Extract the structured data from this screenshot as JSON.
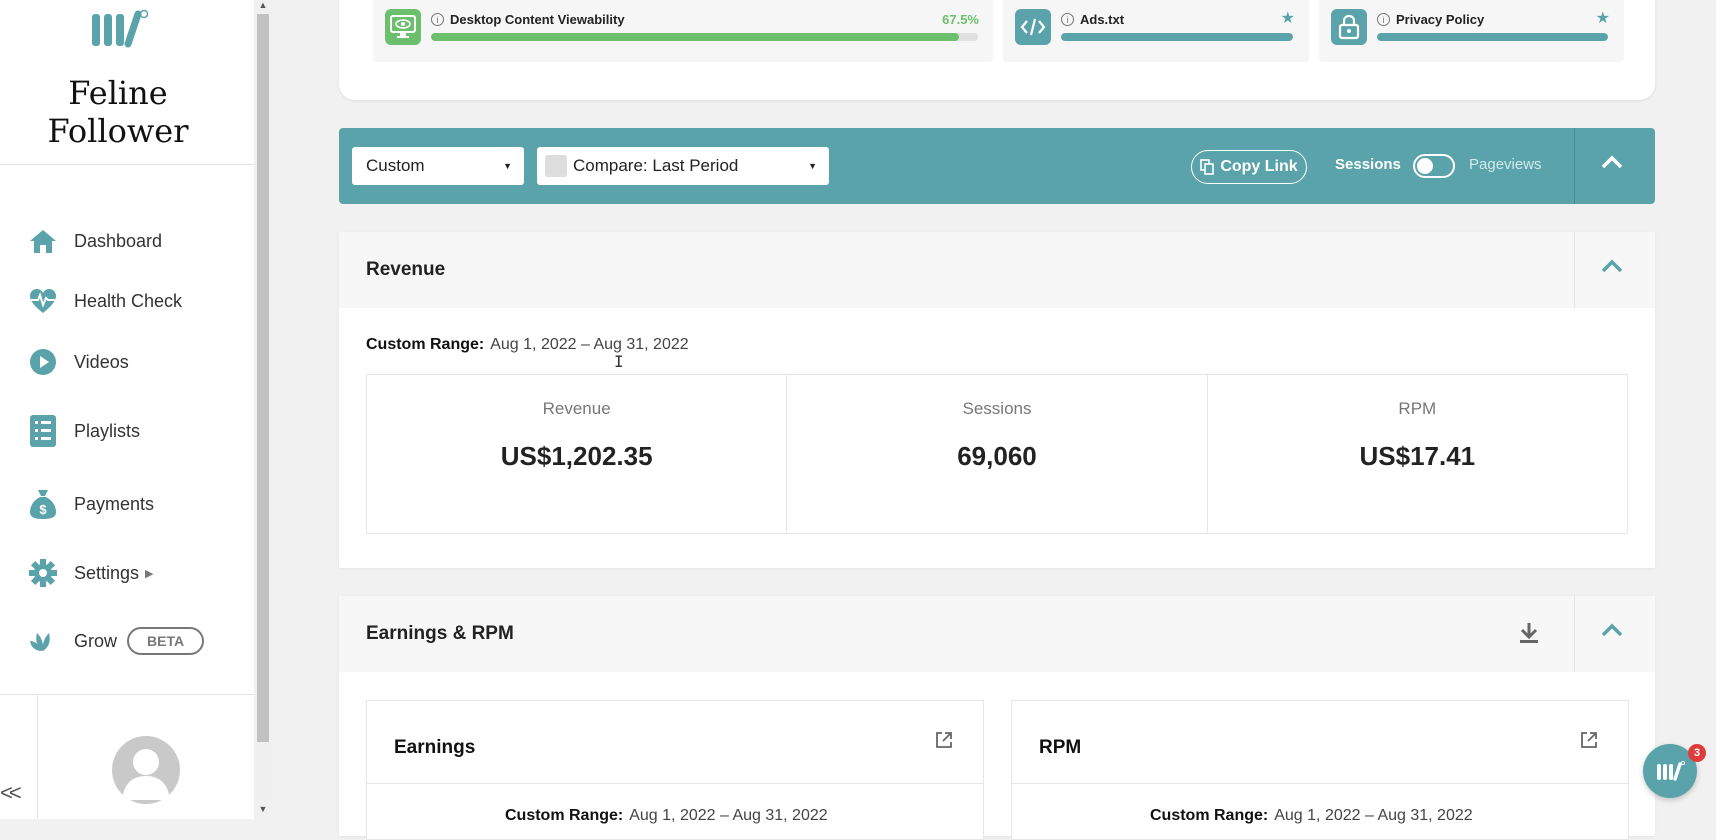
{
  "brand": {
    "name_line1": "Feline",
    "name_line2": "Follower"
  },
  "sidebar": {
    "items": [
      {
        "label": "Dashboard",
        "icon": "home-icon"
      },
      {
        "label": "Health Check",
        "icon": "heartbeat-icon"
      },
      {
        "label": "Videos",
        "icon": "play-icon"
      },
      {
        "label": "Playlists",
        "icon": "list-icon"
      },
      {
        "label": "Payments",
        "icon": "money-bag-icon"
      },
      {
        "label": "Settings",
        "icon": "gear-icon"
      },
      {
        "label": "Grow",
        "icon": "leaf-icon",
        "badge": "BETA"
      }
    ],
    "collapse_label": "<<"
  },
  "metrics": [
    {
      "label": "Desktop Content Viewability",
      "value": "67.5%",
      "progress": 0.965,
      "color": "#6cbf6c",
      "icon": "monitor-eye-icon"
    },
    {
      "label": "Ads.txt",
      "progress": 1.0,
      "color": "#5ba3aa",
      "icon": "code-icon"
    },
    {
      "label": "Privacy Policy",
      "progress": 1.0,
      "color": "#5ba3aa",
      "icon": "lock-icon"
    }
  ],
  "toolbar": {
    "range_select": "Custom",
    "compare_select": "Compare: Last Period",
    "copy_link": "Copy Link",
    "toggle_left": "Sessions",
    "toggle_right": "Pageviews"
  },
  "revenue": {
    "title": "Revenue",
    "range_label": "Custom Range:",
    "range_value": "Aug 1, 2022 – Aug 31, 2022",
    "stats": [
      {
        "label": "Revenue",
        "value": "US$1,202.35"
      },
      {
        "label": "Sessions",
        "value": "69,060"
      },
      {
        "label": "RPM",
        "value": "US$17.41"
      }
    ]
  },
  "earnings_rpm": {
    "title": "Earnings & RPM",
    "cards": [
      {
        "title": "Earnings",
        "range_label": "Custom Range:",
        "range_value": "Aug 1, 2022 – Aug 31, 2022"
      },
      {
        "title": "RPM",
        "range_label": "Custom Range:",
        "range_value": "Aug 1, 2022 – Aug 31, 2022"
      }
    ]
  },
  "chat": {
    "badge_count": "3"
  },
  "colors": {
    "accent": "#5ba3aa",
    "success": "#6cbf6c",
    "badge": "#e03b3b"
  }
}
